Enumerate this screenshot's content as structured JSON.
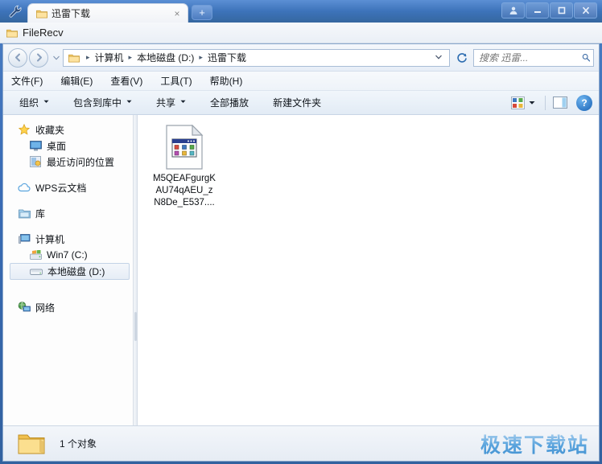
{
  "window": {
    "tool_icon": "wrench-icon",
    "tab": {
      "label": "迅雷下载",
      "close": "×",
      "new_tab": "+"
    },
    "controls": {
      "user": "♟",
      "minimize": "–",
      "maximize": "□",
      "close": "✕"
    },
    "subbar": {
      "label": "FileRecv"
    }
  },
  "address": {
    "back": "◀",
    "forward": "▶",
    "history_caret": "▼",
    "crumbs": [
      "计算机",
      "本地磁盘 (D:)",
      "迅雷下载"
    ],
    "separator": "▸",
    "dropdown_caret": "▼",
    "refresh": "↻"
  },
  "search": {
    "placeholder": "搜索 迅雷...",
    "value": "",
    "icon": "search-icon"
  },
  "menu": {
    "items": [
      "文件(F)",
      "编辑(E)",
      "查看(V)",
      "工具(T)",
      "帮助(H)"
    ]
  },
  "toolbar": {
    "items": [
      {
        "label": "组织",
        "caret": true
      },
      {
        "label": "包含到库中",
        "caret": true
      },
      {
        "label": "共享",
        "caret": true
      },
      {
        "label": "全部播放",
        "caret": false
      },
      {
        "label": "新建文件夹",
        "caret": false
      }
    ],
    "view_caret": "▼",
    "help": "?"
  },
  "sidebar": {
    "groups": [
      {
        "header": {
          "label": "收藏夹",
          "icon": "star-icon"
        },
        "items": [
          {
            "label": "桌面",
            "icon": "desktop-icon",
            "selected": false
          },
          {
            "label": "最近访问的位置",
            "icon": "recent-places-icon",
            "selected": false
          }
        ]
      },
      {
        "header": {
          "label": "WPS云文档",
          "icon": "cloud-icon"
        },
        "items": []
      },
      {
        "header": {
          "label": "库",
          "icon": "library-icon"
        },
        "items": []
      },
      {
        "header": {
          "label": "计算机",
          "icon": "computer-icon"
        },
        "items": [
          {
            "label": "Win7 (C:)",
            "icon": "windows-drive-icon",
            "selected": false
          },
          {
            "label": "本地磁盘 (D:)",
            "icon": "drive-icon",
            "selected": true
          }
        ]
      },
      {
        "header": {
          "label": "网络",
          "icon": "network-icon"
        },
        "items": []
      }
    ]
  },
  "content": {
    "files": [
      {
        "name": "M5QEAFgurgKAU74qAEU_zN8De_E537....",
        "icon": "application-file-icon"
      }
    ]
  },
  "status": {
    "count_text": "1 个对象",
    "folder_icon": "folder-icon",
    "watermark": "极速下载站"
  }
}
